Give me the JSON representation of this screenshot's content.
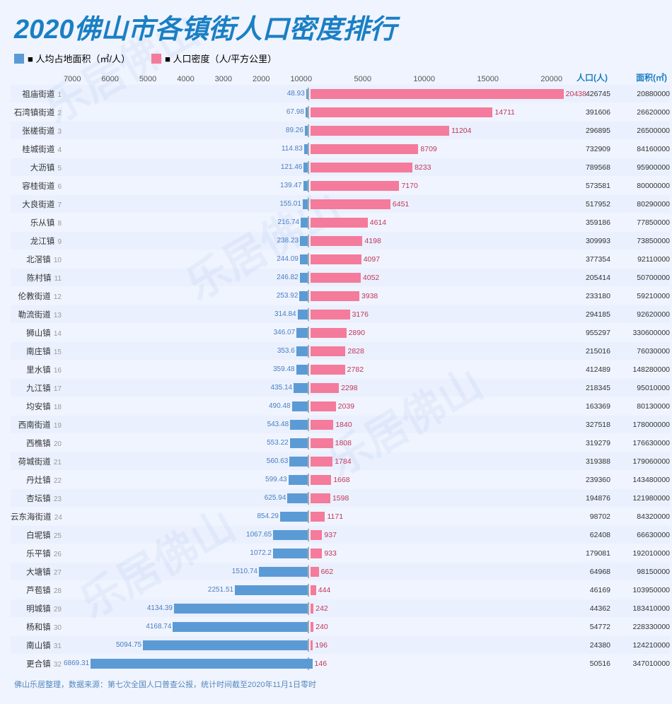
{
  "title": "2020佛山市各镇街人口密度排行",
  "legend": {
    "blue_label": "■ 人均占地面积（㎡/人）",
    "pink_label": "■ 人口密度（人/平方公里）"
  },
  "col_headers": {
    "population": "人口(人)",
    "area": "面积(㎡)"
  },
  "axis_left": [
    "7000",
    "6000",
    "5000",
    "4000",
    "3000",
    "2000",
    "1000"
  ],
  "axis_right": [
    "0",
    "5000",
    "10000",
    "15000",
    "20000"
  ],
  "rows": [
    {
      "name": "祖庙街道",
      "rank": "1",
      "left_val": 48.93,
      "right_val": 20438,
      "population": "426745",
      "area": "20880000"
    },
    {
      "name": "石湾镇街道",
      "rank": "2",
      "left_val": 67.98,
      "right_val": 14711,
      "population": "391606",
      "area": "26620000"
    },
    {
      "name": "张槎街道",
      "rank": "3",
      "left_val": 89.26,
      "right_val": 11204,
      "population": "296895",
      "area": "26500000"
    },
    {
      "name": "桂城街道",
      "rank": "4",
      "left_val": 114.83,
      "right_val": 8709,
      "population": "732909",
      "area": "84160000"
    },
    {
      "name": "大沥镇",
      "rank": "5",
      "left_val": 121.46,
      "right_val": 8233,
      "population": "789568",
      "area": "95900000"
    },
    {
      "name": "容桂街道",
      "rank": "6",
      "left_val": 139.47,
      "right_val": 7170,
      "population": "573581",
      "area": "80000000"
    },
    {
      "name": "大良街道",
      "rank": "7",
      "left_val": 155.01,
      "right_val": 6451,
      "population": "517952",
      "area": "80290000"
    },
    {
      "name": "乐从镇",
      "rank": "8",
      "left_val": 216.74,
      "right_val": 4614,
      "population": "359186",
      "area": "77850000"
    },
    {
      "name": "龙江镇",
      "rank": "9",
      "left_val": 238.23,
      "right_val": 4198,
      "population": "309993",
      "area": "73850000"
    },
    {
      "name": "北滘镇",
      "rank": "10",
      "left_val": 244.09,
      "right_val": 4097,
      "population": "377354",
      "area": "92110000"
    },
    {
      "name": "陈村镇",
      "rank": "11",
      "left_val": 246.82,
      "right_val": 4052,
      "population": "205414",
      "area": "50700000"
    },
    {
      "name": "伦教街道",
      "rank": "12",
      "left_val": 253.92,
      "right_val": 3938,
      "population": "233180",
      "area": "59210000"
    },
    {
      "name": "勒流街道",
      "rank": "13",
      "left_val": 314.84,
      "right_val": 3176,
      "population": "294185",
      "area": "92620000"
    },
    {
      "name": "狮山镇",
      "rank": "14",
      "left_val": 346.07,
      "right_val": 2890,
      "population": "955297",
      "area": "330600000"
    },
    {
      "name": "南庄镇",
      "rank": "15",
      "left_val": 353.6,
      "right_val": 2828,
      "population": "215016",
      "area": "76030000"
    },
    {
      "name": "里水镇",
      "rank": "16",
      "left_val": 359.48,
      "right_val": 2782,
      "population": "412489",
      "area": "148280000"
    },
    {
      "name": "九江镇",
      "rank": "17",
      "left_val": 435.14,
      "right_val": 2298,
      "population": "218345",
      "area": "95010000"
    },
    {
      "name": "均安镇",
      "rank": "18",
      "left_val": 490.48,
      "right_val": 2039,
      "population": "163369",
      "area": "80130000"
    },
    {
      "name": "西南街道",
      "rank": "19",
      "left_val": 543.48,
      "right_val": 1840,
      "population": "327518",
      "area": "178000000"
    },
    {
      "name": "西樵镇",
      "rank": "20",
      "left_val": 553.22,
      "right_val": 1808,
      "population": "319279",
      "area": "176630000"
    },
    {
      "name": "荷城街道",
      "rank": "21",
      "left_val": 560.63,
      "right_val": 1784,
      "population": "319388",
      "area": "179060000"
    },
    {
      "name": "丹灶镇",
      "rank": "22",
      "left_val": 599.43,
      "right_val": 1668,
      "population": "239360",
      "area": "143480000"
    },
    {
      "name": "杏坛镇",
      "rank": "23",
      "left_val": 625.94,
      "right_val": 1598,
      "population": "194876",
      "area": "121980000"
    },
    {
      "name": "云东海街道",
      "rank": "24",
      "left_val": 854.29,
      "right_val": 1171,
      "population": "98702",
      "area": "84320000"
    },
    {
      "name": "白坭镇",
      "rank": "25",
      "left_val": 1067.65,
      "right_val": 937,
      "population": "62408",
      "area": "66630000"
    },
    {
      "name": "乐平镇",
      "rank": "26",
      "left_val": 1072.2,
      "right_val": 933,
      "population": "179081",
      "area": "192010000"
    },
    {
      "name": "大塘镇",
      "rank": "27",
      "left_val": 1510.74,
      "right_val": 662,
      "population": "64968",
      "area": "98150000"
    },
    {
      "name": "芦苞镇",
      "rank": "28",
      "left_val": 2251.51,
      "right_val": 444,
      "population": "46169",
      "area": "103950000"
    },
    {
      "name": "明城镇",
      "rank": "29",
      "left_val": 4134.39,
      "right_val": 242,
      "population": "44362",
      "area": "183410000"
    },
    {
      "name": "杨和镇",
      "rank": "30",
      "left_val": 4168.74,
      "right_val": 240,
      "population": "54772",
      "area": "228330000"
    },
    {
      "name": "南山镇",
      "rank": "31",
      "left_val": 5094.75,
      "right_val": 196,
      "population": "24380",
      "area": "124210000"
    },
    {
      "name": "更合镇",
      "rank": "32",
      "left_val": 6869.31,
      "right_val": 146,
      "population": "50516",
      "area": "347010000"
    }
  ],
  "footer": "佛山乐居整理，数据来源：第七次全国人口普查公报，统计时间截至2020年11月1日零时"
}
